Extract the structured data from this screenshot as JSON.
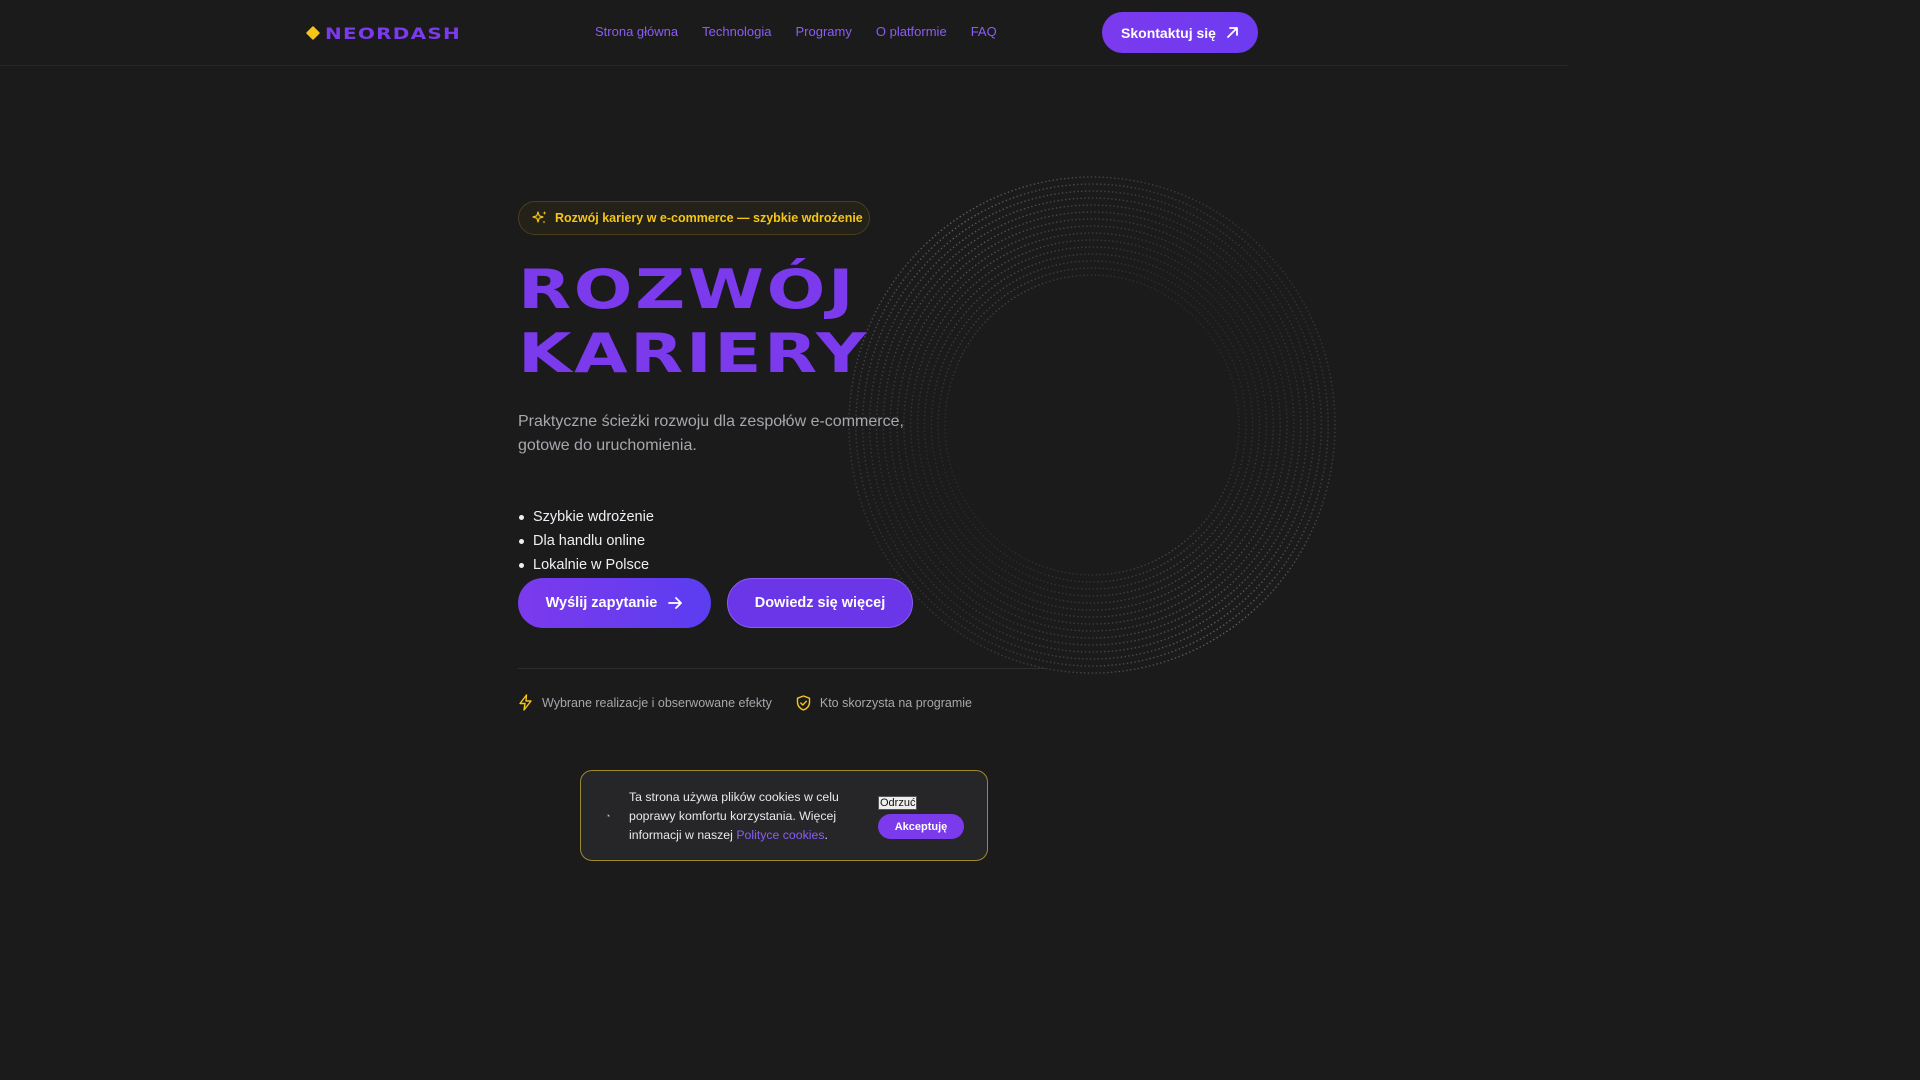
{
  "brand": {
    "name": "NEORDASH"
  },
  "nav": {
    "items": [
      {
        "label": "Strona główna"
      },
      {
        "label": "Technologia"
      },
      {
        "label": "Programy"
      },
      {
        "label": "O platformie"
      },
      {
        "label": "FAQ"
      }
    ],
    "contact_label": "Skontaktuj się"
  },
  "hero": {
    "badge": "Rozwój kariery w e-commerce — szybkie wdrożenie",
    "title_line1": "ROZWÓJ",
    "title_line2": "KARIERY",
    "subtitle": "Praktyczne ścieżki rozwoju dla zespołów e-commerce, gotowe do uruchomienia.",
    "features": [
      "Szybkie wdrożenie",
      "Dla handlu online",
      "Lokalnie w Polsce"
    ],
    "primary_cta": "Wyślij zapytanie",
    "secondary_cta": "Dowiedz się więcej",
    "trust": [
      {
        "icon": "lightning-icon",
        "label": "Wybrane realizacje i obserwowane efekty"
      },
      {
        "icon": "shield-check-icon",
        "label": "Kto skorzysta na programie"
      }
    ]
  },
  "cookie": {
    "icon": "cookie-icon",
    "text": "Ta strona używa plików cookies w celu poprawy komfortu korzystania. Więcej informacji w naszej",
    "link": "Polityce cookies",
    "suffix": ".",
    "reject_label": "Odrzuć",
    "accept_label": "Akceptuję"
  },
  "colors": {
    "background": "#1b1b1c",
    "accent": "#7c3aed",
    "highlight": "#f5c518"
  }
}
